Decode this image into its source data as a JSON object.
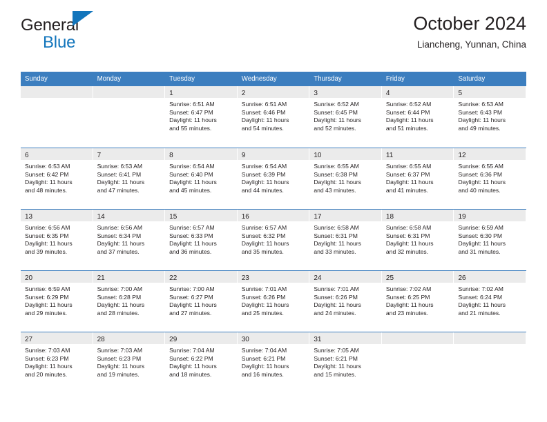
{
  "brand": {
    "line1": "General",
    "line2": "Blue",
    "accent_color": "#1275bc",
    "triangle_icon": "brand-triangle-icon"
  },
  "header": {
    "title": "October 2024",
    "location": "Liancheng, Yunnan, China",
    "header_bg_color": "#3c7ebf",
    "day_band_color": "#ebebeb"
  },
  "weekdays": [
    {
      "label": "Sunday"
    },
    {
      "label": "Monday"
    },
    {
      "label": "Tuesday"
    },
    {
      "label": "Wednesday"
    },
    {
      "label": "Thursday"
    },
    {
      "label": "Friday"
    },
    {
      "label": "Saturday"
    }
  ],
  "labels": {
    "sunrise_prefix": "Sunrise:",
    "sunset_prefix": "Sunset:",
    "daylight_prefix": "Daylight:"
  },
  "weeks": [
    {
      "days": [
        {
          "day": "",
          "empty": true,
          "lines": []
        },
        {
          "day": "",
          "empty": true,
          "lines": []
        },
        {
          "day": "1",
          "empty": false,
          "sunrise": "6:51 AM",
          "sunset": "6:47 PM",
          "daylight_hours": "11",
          "daylight_minutes": "55",
          "lines": [
            "Sunrise: 6:51 AM",
            "Sunset: 6:47 PM",
            "Daylight: 11 hours",
            "and 55 minutes."
          ]
        },
        {
          "day": "2",
          "empty": false,
          "sunrise": "6:51 AM",
          "sunset": "6:46 PM",
          "daylight_hours": "11",
          "daylight_minutes": "54",
          "lines": [
            "Sunrise: 6:51 AM",
            "Sunset: 6:46 PM",
            "Daylight: 11 hours",
            "and 54 minutes."
          ]
        },
        {
          "day": "3",
          "empty": false,
          "sunrise": "6:52 AM",
          "sunset": "6:45 PM",
          "daylight_hours": "11",
          "daylight_minutes": "52",
          "lines": [
            "Sunrise: 6:52 AM",
            "Sunset: 6:45 PM",
            "Daylight: 11 hours",
            "and 52 minutes."
          ]
        },
        {
          "day": "4",
          "empty": false,
          "sunrise": "6:52 AM",
          "sunset": "6:44 PM",
          "daylight_hours": "11",
          "daylight_minutes": "51",
          "lines": [
            "Sunrise: 6:52 AM",
            "Sunset: 6:44 PM",
            "Daylight: 11 hours",
            "and 51 minutes."
          ]
        },
        {
          "day": "5",
          "empty": false,
          "sunrise": "6:53 AM",
          "sunset": "6:43 PM",
          "daylight_hours": "11",
          "daylight_minutes": "49",
          "lines": [
            "Sunrise: 6:53 AM",
            "Sunset: 6:43 PM",
            "Daylight: 11 hours",
            "and 49 minutes."
          ]
        }
      ]
    },
    {
      "days": [
        {
          "day": "6",
          "empty": false,
          "sunrise": "6:53 AM",
          "sunset": "6:42 PM",
          "daylight_hours": "11",
          "daylight_minutes": "48",
          "lines": [
            "Sunrise: 6:53 AM",
            "Sunset: 6:42 PM",
            "Daylight: 11 hours",
            "and 48 minutes."
          ]
        },
        {
          "day": "7",
          "empty": false,
          "sunrise": "6:53 AM",
          "sunset": "6:41 PM",
          "daylight_hours": "11",
          "daylight_minutes": "47",
          "lines": [
            "Sunrise: 6:53 AM",
            "Sunset: 6:41 PM",
            "Daylight: 11 hours",
            "and 47 minutes."
          ]
        },
        {
          "day": "8",
          "empty": false,
          "sunrise": "6:54 AM",
          "sunset": "6:40 PM",
          "daylight_hours": "11",
          "daylight_minutes": "45",
          "lines": [
            "Sunrise: 6:54 AM",
            "Sunset: 6:40 PM",
            "Daylight: 11 hours",
            "and 45 minutes."
          ]
        },
        {
          "day": "9",
          "empty": false,
          "sunrise": "6:54 AM",
          "sunset": "6:39 PM",
          "daylight_hours": "11",
          "daylight_minutes": "44",
          "lines": [
            "Sunrise: 6:54 AM",
            "Sunset: 6:39 PM",
            "Daylight: 11 hours",
            "and 44 minutes."
          ]
        },
        {
          "day": "10",
          "empty": false,
          "sunrise": "6:55 AM",
          "sunset": "6:38 PM",
          "daylight_hours": "11",
          "daylight_minutes": "43",
          "lines": [
            "Sunrise: 6:55 AM",
            "Sunset: 6:38 PM",
            "Daylight: 11 hours",
            "and 43 minutes."
          ]
        },
        {
          "day": "11",
          "empty": false,
          "sunrise": "6:55 AM",
          "sunset": "6:37 PM",
          "daylight_hours": "11",
          "daylight_minutes": "41",
          "lines": [
            "Sunrise: 6:55 AM",
            "Sunset: 6:37 PM",
            "Daylight: 11 hours",
            "and 41 minutes."
          ]
        },
        {
          "day": "12",
          "empty": false,
          "sunrise": "6:55 AM",
          "sunset": "6:36 PM",
          "daylight_hours": "11",
          "daylight_minutes": "40",
          "lines": [
            "Sunrise: 6:55 AM",
            "Sunset: 6:36 PM",
            "Daylight: 11 hours",
            "and 40 minutes."
          ]
        }
      ]
    },
    {
      "days": [
        {
          "day": "13",
          "empty": false,
          "sunrise": "6:56 AM",
          "sunset": "6:35 PM",
          "daylight_hours": "11",
          "daylight_minutes": "39",
          "lines": [
            "Sunrise: 6:56 AM",
            "Sunset: 6:35 PM",
            "Daylight: 11 hours",
            "and 39 minutes."
          ]
        },
        {
          "day": "14",
          "empty": false,
          "sunrise": "6:56 AM",
          "sunset": "6:34 PM",
          "daylight_hours": "11",
          "daylight_minutes": "37",
          "lines": [
            "Sunrise: 6:56 AM",
            "Sunset: 6:34 PM",
            "Daylight: 11 hours",
            "and 37 minutes."
          ]
        },
        {
          "day": "15",
          "empty": false,
          "sunrise": "6:57 AM",
          "sunset": "6:33 PM",
          "daylight_hours": "11",
          "daylight_minutes": "36",
          "lines": [
            "Sunrise: 6:57 AM",
            "Sunset: 6:33 PM",
            "Daylight: 11 hours",
            "and 36 minutes."
          ]
        },
        {
          "day": "16",
          "empty": false,
          "sunrise": "6:57 AM",
          "sunset": "6:32 PM",
          "daylight_hours": "11",
          "daylight_minutes": "35",
          "lines": [
            "Sunrise: 6:57 AM",
            "Sunset: 6:32 PM",
            "Daylight: 11 hours",
            "and 35 minutes."
          ]
        },
        {
          "day": "17",
          "empty": false,
          "sunrise": "6:58 AM",
          "sunset": "6:31 PM",
          "daylight_hours": "11",
          "daylight_minutes": "33",
          "lines": [
            "Sunrise: 6:58 AM",
            "Sunset: 6:31 PM",
            "Daylight: 11 hours",
            "and 33 minutes."
          ]
        },
        {
          "day": "18",
          "empty": false,
          "sunrise": "6:58 AM",
          "sunset": "6:31 PM",
          "daylight_hours": "11",
          "daylight_minutes": "32",
          "lines": [
            "Sunrise: 6:58 AM",
            "Sunset: 6:31 PM",
            "Daylight: 11 hours",
            "and 32 minutes."
          ]
        },
        {
          "day": "19",
          "empty": false,
          "sunrise": "6:59 AM",
          "sunset": "6:30 PM",
          "daylight_hours": "11",
          "daylight_minutes": "31",
          "lines": [
            "Sunrise: 6:59 AM",
            "Sunset: 6:30 PM",
            "Daylight: 11 hours",
            "and 31 minutes."
          ]
        }
      ]
    },
    {
      "days": [
        {
          "day": "20",
          "empty": false,
          "sunrise": "6:59 AM",
          "sunset": "6:29 PM",
          "daylight_hours": "11",
          "daylight_minutes": "29",
          "lines": [
            "Sunrise: 6:59 AM",
            "Sunset: 6:29 PM",
            "Daylight: 11 hours",
            "and 29 minutes."
          ]
        },
        {
          "day": "21",
          "empty": false,
          "sunrise": "7:00 AM",
          "sunset": "6:28 PM",
          "daylight_hours": "11",
          "daylight_minutes": "28",
          "lines": [
            "Sunrise: 7:00 AM",
            "Sunset: 6:28 PM",
            "Daylight: 11 hours",
            "and 28 minutes."
          ]
        },
        {
          "day": "22",
          "empty": false,
          "sunrise": "7:00 AM",
          "sunset": "6:27 PM",
          "daylight_hours": "11",
          "daylight_minutes": "27",
          "lines": [
            "Sunrise: 7:00 AM",
            "Sunset: 6:27 PM",
            "Daylight: 11 hours",
            "and 27 minutes."
          ]
        },
        {
          "day": "23",
          "empty": false,
          "sunrise": "7:01 AM",
          "sunset": "6:26 PM",
          "daylight_hours": "11",
          "daylight_minutes": "25",
          "lines": [
            "Sunrise: 7:01 AM",
            "Sunset: 6:26 PM",
            "Daylight: 11 hours",
            "and 25 minutes."
          ]
        },
        {
          "day": "24",
          "empty": false,
          "sunrise": "7:01 AM",
          "sunset": "6:26 PM",
          "daylight_hours": "11",
          "daylight_minutes": "24",
          "lines": [
            "Sunrise: 7:01 AM",
            "Sunset: 6:26 PM",
            "Daylight: 11 hours",
            "and 24 minutes."
          ]
        },
        {
          "day": "25",
          "empty": false,
          "sunrise": "7:02 AM",
          "sunset": "6:25 PM",
          "daylight_hours": "11",
          "daylight_minutes": "23",
          "lines": [
            "Sunrise: 7:02 AM",
            "Sunset: 6:25 PM",
            "Daylight: 11 hours",
            "and 23 minutes."
          ]
        },
        {
          "day": "26",
          "empty": false,
          "sunrise": "7:02 AM",
          "sunset": "6:24 PM",
          "daylight_hours": "11",
          "daylight_minutes": "21",
          "lines": [
            "Sunrise: 7:02 AM",
            "Sunset: 6:24 PM",
            "Daylight: 11 hours",
            "and 21 minutes."
          ]
        }
      ]
    },
    {
      "days": [
        {
          "day": "27",
          "empty": false,
          "sunrise": "7:03 AM",
          "sunset": "6:23 PM",
          "daylight_hours": "11",
          "daylight_minutes": "20",
          "lines": [
            "Sunrise: 7:03 AM",
            "Sunset: 6:23 PM",
            "Daylight: 11 hours",
            "and 20 minutes."
          ]
        },
        {
          "day": "28",
          "empty": false,
          "sunrise": "7:03 AM",
          "sunset": "6:23 PM",
          "daylight_hours": "11",
          "daylight_minutes": "19",
          "lines": [
            "Sunrise: 7:03 AM",
            "Sunset: 6:23 PM",
            "Daylight: 11 hours",
            "and 19 minutes."
          ]
        },
        {
          "day": "29",
          "empty": false,
          "sunrise": "7:04 AM",
          "sunset": "6:22 PM",
          "daylight_hours": "11",
          "daylight_minutes": "18",
          "lines": [
            "Sunrise: 7:04 AM",
            "Sunset: 6:22 PM",
            "Daylight: 11 hours",
            "and 18 minutes."
          ]
        },
        {
          "day": "30",
          "empty": false,
          "sunrise": "7:04 AM",
          "sunset": "6:21 PM",
          "daylight_hours": "11",
          "daylight_minutes": "16",
          "lines": [
            "Sunrise: 7:04 AM",
            "Sunset: 6:21 PM",
            "Daylight: 11 hours",
            "and 16 minutes."
          ]
        },
        {
          "day": "31",
          "empty": false,
          "sunrise": "7:05 AM",
          "sunset": "6:21 PM",
          "daylight_hours": "11",
          "daylight_minutes": "15",
          "lines": [
            "Sunrise: 7:05 AM",
            "Sunset: 6:21 PM",
            "Daylight: 11 hours",
            "and 15 minutes."
          ]
        },
        {
          "day": "",
          "empty": true,
          "lines": []
        },
        {
          "day": "",
          "empty": true,
          "lines": []
        }
      ]
    }
  ]
}
